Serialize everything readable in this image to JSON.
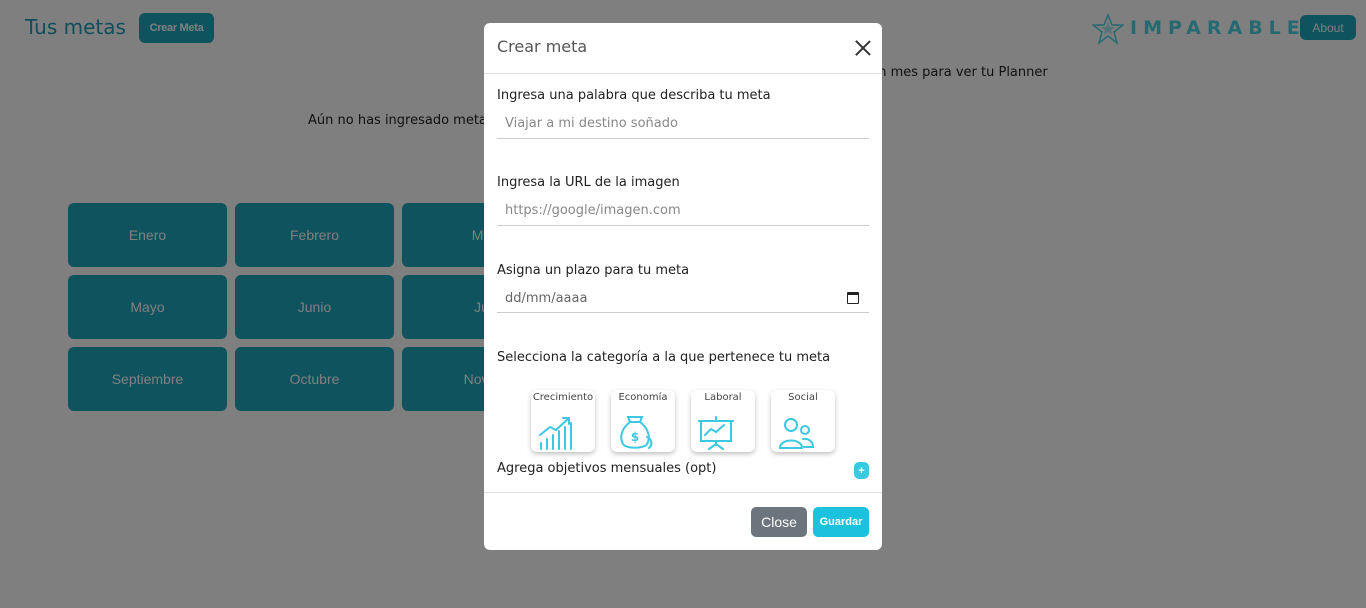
{
  "header": {
    "title": "Tus metas",
    "create_button": "Crear Meta",
    "logo_text": "IMPARABLE",
    "about_button": "About"
  },
  "main": {
    "hint_text": "un mes para ver tu Planner",
    "empty_text": "Aún no has ingresado meta",
    "months": [
      "Enero",
      "Febrero",
      "Ma",
      "Mayo",
      "Junio",
      "Ju",
      "Septiembre",
      "Octubre",
      "Novie"
    ]
  },
  "modal": {
    "title": "Crear meta",
    "word_label": "Ingresa una palabra que describa tu meta",
    "word_placeholder": "Viajar a mi destino soñado",
    "url_label": "Ingresa la URL de la imagen",
    "url_placeholder": "https://google/imagen.com",
    "deadline_label": "Asigna un plazo para tu meta",
    "deadline_value": "dd/mm/aaaa",
    "category_label": "Selecciona la categoría a la que pertenece tu meta",
    "categories": [
      {
        "label": "Crecimiento",
        "icon": "growth-chart-icon"
      },
      {
        "label": "Economía",
        "icon": "money-bag-icon"
      },
      {
        "label": "Laboral",
        "icon": "presentation-board-icon"
      },
      {
        "label": "Social",
        "icon": "people-icon"
      }
    ],
    "objectives_label": "Agrega objetivos mensuales (opt)",
    "add_symbol": "+",
    "close_button": "Close",
    "save_button": "Guardar"
  },
  "colors": {
    "primary": "#1ca6bd",
    "accent": "#1cc1de",
    "icon": "#3bc8e0",
    "secondary": "#6c757d"
  }
}
